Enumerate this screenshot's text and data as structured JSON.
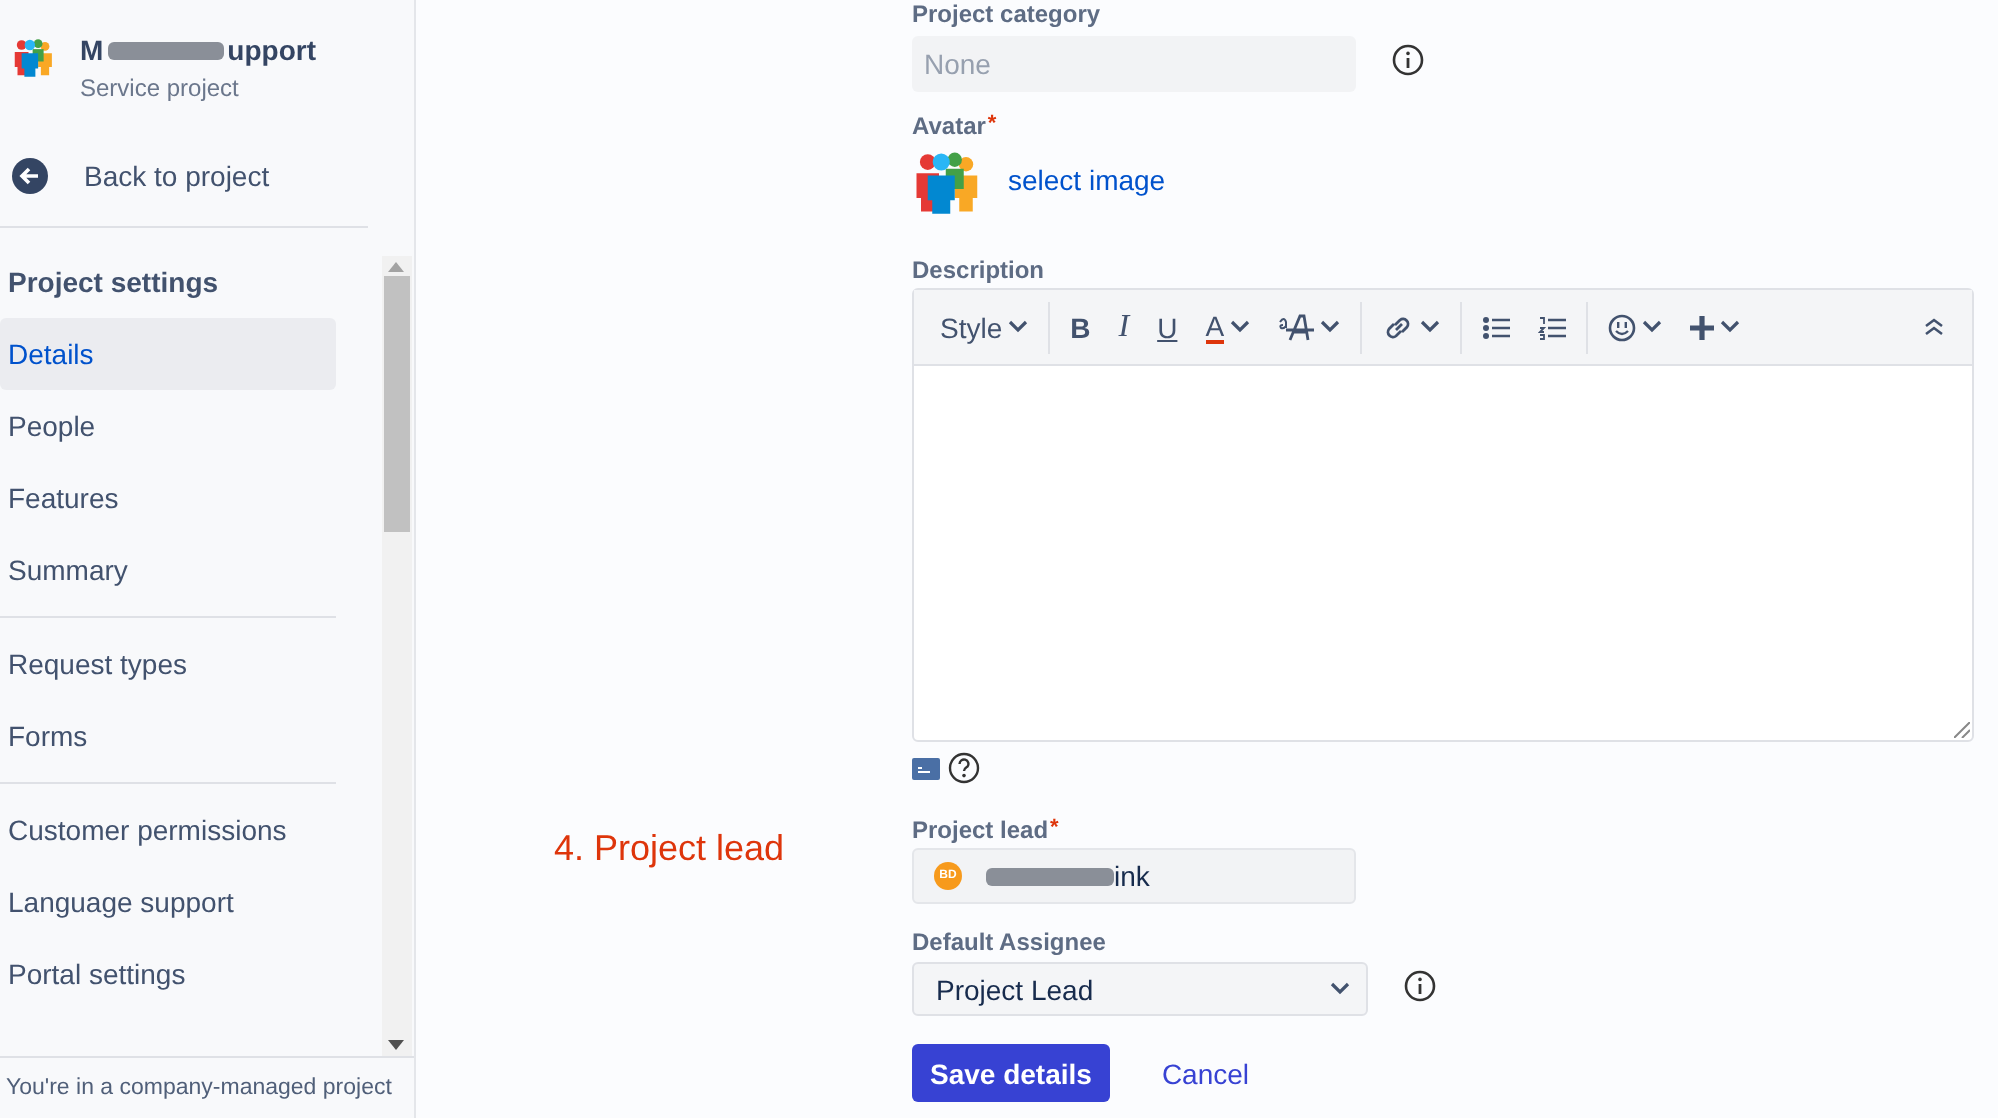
{
  "sidebar": {
    "project": {
      "name_start": "M",
      "name_end": "upport",
      "type": "Service project"
    },
    "back_link": "Back to project",
    "section_title": "Project settings",
    "groups": [
      [
        {
          "label": "Details",
          "selected": true
        },
        {
          "label": "People",
          "selected": false
        },
        {
          "label": "Features",
          "selected": false
        },
        {
          "label": "Summary",
          "selected": false
        }
      ],
      [
        {
          "label": "Request types",
          "selected": false
        },
        {
          "label": "Forms",
          "selected": false
        }
      ],
      [
        {
          "label": "Customer permissions",
          "selected": false
        },
        {
          "label": "Language support",
          "selected": false
        },
        {
          "label": "Portal settings",
          "selected": false
        }
      ]
    ],
    "footer": "You're in a company-managed project"
  },
  "annotation": "4. Project lead",
  "form": {
    "category": {
      "label": "Project category",
      "placeholder": "None"
    },
    "avatar": {
      "label": "Avatar",
      "required_mark": "*",
      "link": "select image"
    },
    "description": {
      "label": "Description",
      "toolbar": [
        {
          "kind": "style",
          "text": "Style"
        },
        {
          "kind": "divider"
        },
        {
          "kind": "bold",
          "text": "B"
        },
        {
          "kind": "italic",
          "text": "I"
        },
        {
          "kind": "underline",
          "text": "U"
        },
        {
          "kind": "color",
          "text": "A"
        },
        {
          "kind": "size"
        },
        {
          "kind": "divider"
        },
        {
          "kind": "link"
        },
        {
          "kind": "divider"
        },
        {
          "kind": "bullets"
        },
        {
          "kind": "numbers"
        },
        {
          "kind": "divider"
        },
        {
          "kind": "emoji"
        },
        {
          "kind": "insert"
        }
      ]
    },
    "lead": {
      "label": "Project lead",
      "required_mark": "*",
      "initials": "BD",
      "value_end": "ink"
    },
    "assignee": {
      "label": "Default Assignee",
      "value": "Project Lead"
    },
    "save": "Save details",
    "cancel": "Cancel"
  }
}
